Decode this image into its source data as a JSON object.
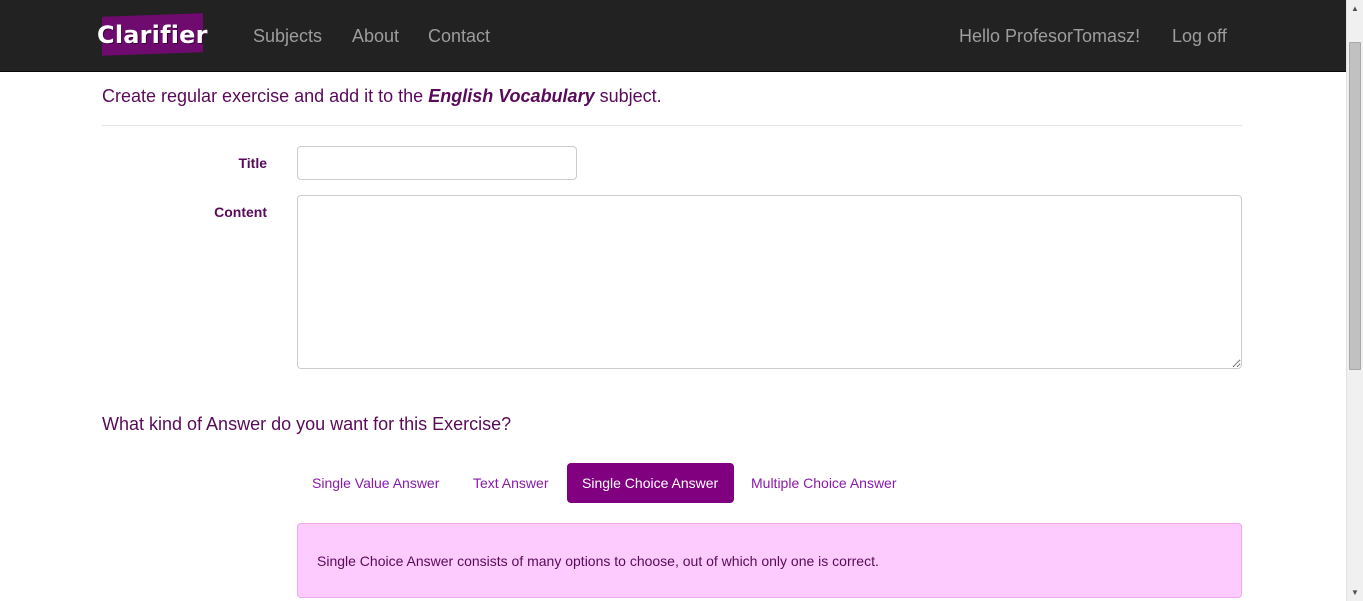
{
  "navbar": {
    "brand": "Clarifier",
    "links": [
      {
        "label": "Subjects"
      },
      {
        "label": "About"
      },
      {
        "label": "Contact"
      }
    ],
    "greeting": "Hello ProfesorTomasz!",
    "logoff": "Log off"
  },
  "page": {
    "heading_prefix": "Create regular exercise and add it to the ",
    "subject": "English Vocabulary",
    "heading_suffix": " subject."
  },
  "form": {
    "title_label": "Title",
    "title_value": "",
    "content_label": "Content",
    "content_value": ""
  },
  "answer_type": {
    "question": "What kind of Answer do you want for this Exercise?",
    "options": [
      {
        "label": "Single Value Answer",
        "active": false
      },
      {
        "label": "Text Answer",
        "active": false
      },
      {
        "label": "Single Choice Answer",
        "active": true
      },
      {
        "label": "Multiple Choice Answer",
        "active": false
      }
    ],
    "description": "Single Choice Answer consists of many options to choose, out of which only one is correct."
  },
  "colors": {
    "navbar_bg": "#222222",
    "brand_bg": "#6f0a6f",
    "text_purple": "#5a0a5a",
    "pill_active": "#800080",
    "info_bg": "#fdcbfd"
  }
}
